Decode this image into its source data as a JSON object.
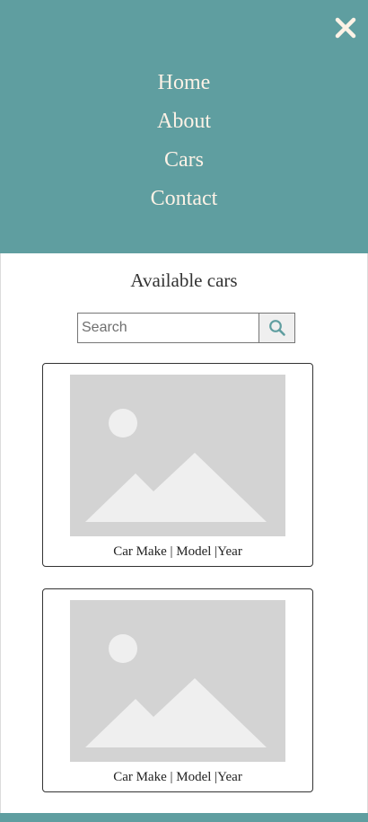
{
  "nav": {
    "close_icon": "close-x-icon",
    "links": [
      {
        "label": "Home"
      },
      {
        "label": "About"
      },
      {
        "label": "Cars"
      },
      {
        "label": "Contact"
      }
    ]
  },
  "main": {
    "heading": "Available cars",
    "search": {
      "placeholder": "Search",
      "value": "",
      "button_icon": "search-icon"
    },
    "cards": [
      {
        "caption": "Car Make | Model |Year",
        "image_icon": "image-placeholder-icon"
      },
      {
        "caption": "Car Make | Model |Year",
        "image_icon": "image-placeholder-icon"
      }
    ]
  },
  "colors": {
    "brand": "#5f9ea0",
    "nav_text": "#fdf2e6",
    "placeholder_bg": "#d3d3d3",
    "placeholder_fg": "#efefef"
  }
}
